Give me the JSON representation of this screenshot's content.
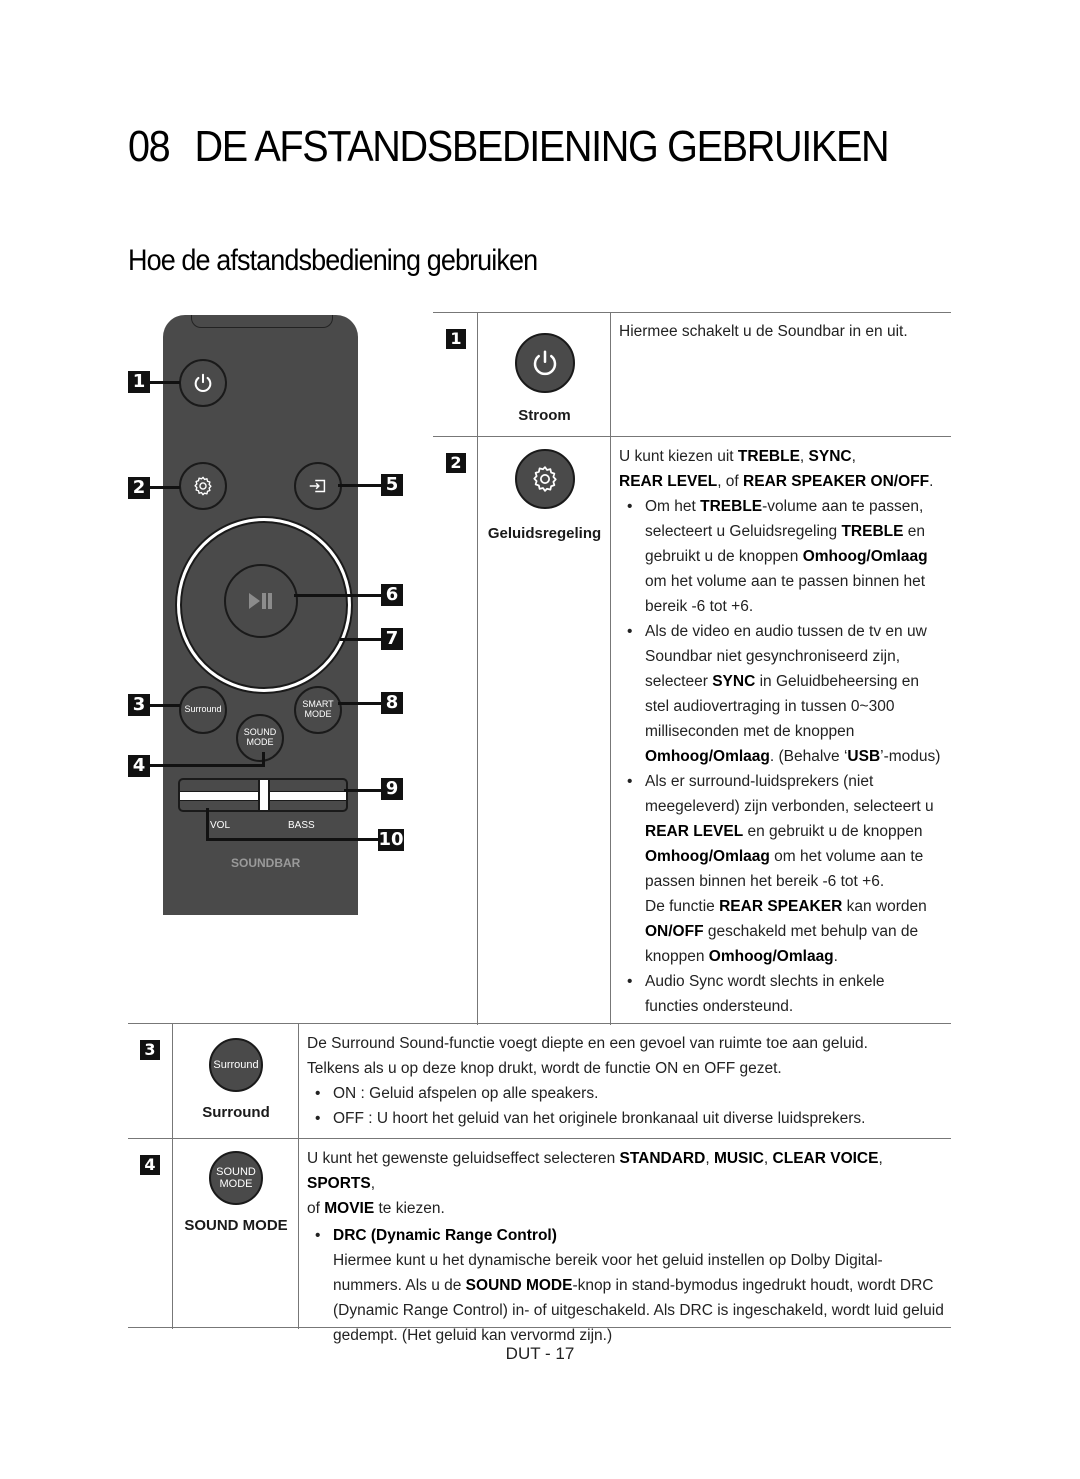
{
  "heading": {
    "number": "08",
    "title": "DE AFSTANDSBEDIENING GEBRUIKEN"
  },
  "subheading": "Hoe de afstandsbediening gebruiken",
  "remote": {
    "callouts": [
      "1",
      "2",
      "3",
      "4",
      "5",
      "6",
      "7",
      "8",
      "9",
      "10"
    ],
    "buttons": {
      "power": "power-icon",
      "settings": "gear-icon",
      "source": "source-input-icon",
      "play_pause": "play-pause-icon",
      "surround": "Surround",
      "sound_mode_line1": "SOUND",
      "sound_mode_line2": "MODE",
      "smart_mode_line1": "SMART",
      "smart_mode_line2": "MODE",
      "vol": "VOL",
      "bass": "BASS"
    },
    "brand_label": "SOUNDBAR"
  },
  "table": [
    {
      "num": "1",
      "icon": "power-icon",
      "caption": "Stroom",
      "text": "Hiermee schakelt u de Soundbar in en uit."
    },
    {
      "num": "2",
      "icon": "gear-icon",
      "caption": "Geluidsregeling",
      "intro_a": "U kunt kiezen uit ",
      "intro_b1": "TREBLE",
      "intro_c": ", ",
      "intro_b2": "SYNC",
      "intro_d": ",",
      "intro_b3": "REAR LEVEL",
      "intro_e": ", of ",
      "intro_b4": "REAR SPEAKER ON/OFF",
      "intro_f": ".",
      "bullets": [
        {
          "p1": "Om het ",
          "b1": "TREBLE",
          "p2": "-volume aan te passen, selecteert u Geluidsregeling ",
          "b2": "TREBLE",
          "p3": " en gebruikt u de knoppen ",
          "b3": "Omhoog/Omlaag",
          "p4": " om het volume aan te passen binnen het bereik -6 tot +6."
        },
        {
          "p1": "Als de video en audio tussen de tv en uw Soundbar niet gesynchroniseerd zijn, selecteer ",
          "b1": "SYNC",
          "p2": " in Geluidbeheersing en stel audiovertraging in tussen 0~300 milliseconden met de knoppen ",
          "b2": "Omhoog/Omlaag",
          "p3": ". (Behalve ‘",
          "b3": "USB",
          "p4": "’-modus)"
        },
        {
          "p1": "Als er surround-luidsprekers (niet meegeleverd) zijn verbonden, selecteert u ",
          "b1": "REAR LEVEL",
          "p2": " en gebruikt u de knoppen ",
          "b2": "Omhoog/Omlaag",
          "p3": " om het volume aan te passen binnen het bereik -6 tot +6.",
          "p4": "De functie ",
          "b4": "REAR SPEAKER",
          "p5": " kan worden ",
          "b5": "ON/OFF",
          "p6": " geschakeld met behulp van de knoppen ",
          "b6": "Omhoog/Omlaag",
          "p7": "."
        },
        {
          "p1": "Audio Sync wordt slechts in enkele functies ondersteund."
        }
      ]
    },
    {
      "num": "3",
      "icon_label": "Surround",
      "caption": "Surround",
      "line1": "De Surround Sound-functie voegt diepte en een gevoel van ruimte toe aan geluid.",
      "line2": "Telkens als u op deze knop drukt, wordt de functie ON en OFF gezet.",
      "bullets": [
        "ON : Geluid afspelen op alle speakers.",
        "OFF : U hoort het geluid van het originele bronkanaal uit diverse luidsprekers."
      ]
    },
    {
      "num": "4",
      "icon_label_1": "SOUND",
      "icon_label_2": "MODE",
      "caption": "SOUND MODE",
      "intro_a": "U kunt het gewenste geluidseffect selecteren ",
      "intro_b1": "STANDARD",
      "intro_c": ", ",
      "intro_b2": "MUSIC",
      "intro_b3": "CLEAR VOICE",
      "intro_b4": "SPORTS",
      "intro_d": ",",
      "intro_e": "of ",
      "intro_b5": "MOVIE",
      "intro_f": " te kiezen.",
      "drc_title": "DRC (Dynamic Range Control)",
      "drc_p1": "Hiermee kunt u het dynamische bereik voor het geluid instellen op Dolby Digital-nummers. Als u de ",
      "drc_b1": "SOUND MODE",
      "drc_p2": "-knop in stand-bymodus ingedrukt houdt, wordt DRC (Dynamic Range Control) in- of uitgeschakeld. Als DRC is ingeschakeld, wordt luid geluid gedempt. (Het geluid kan vervormd zijn.)"
    }
  ],
  "footer": "DUT - 17"
}
